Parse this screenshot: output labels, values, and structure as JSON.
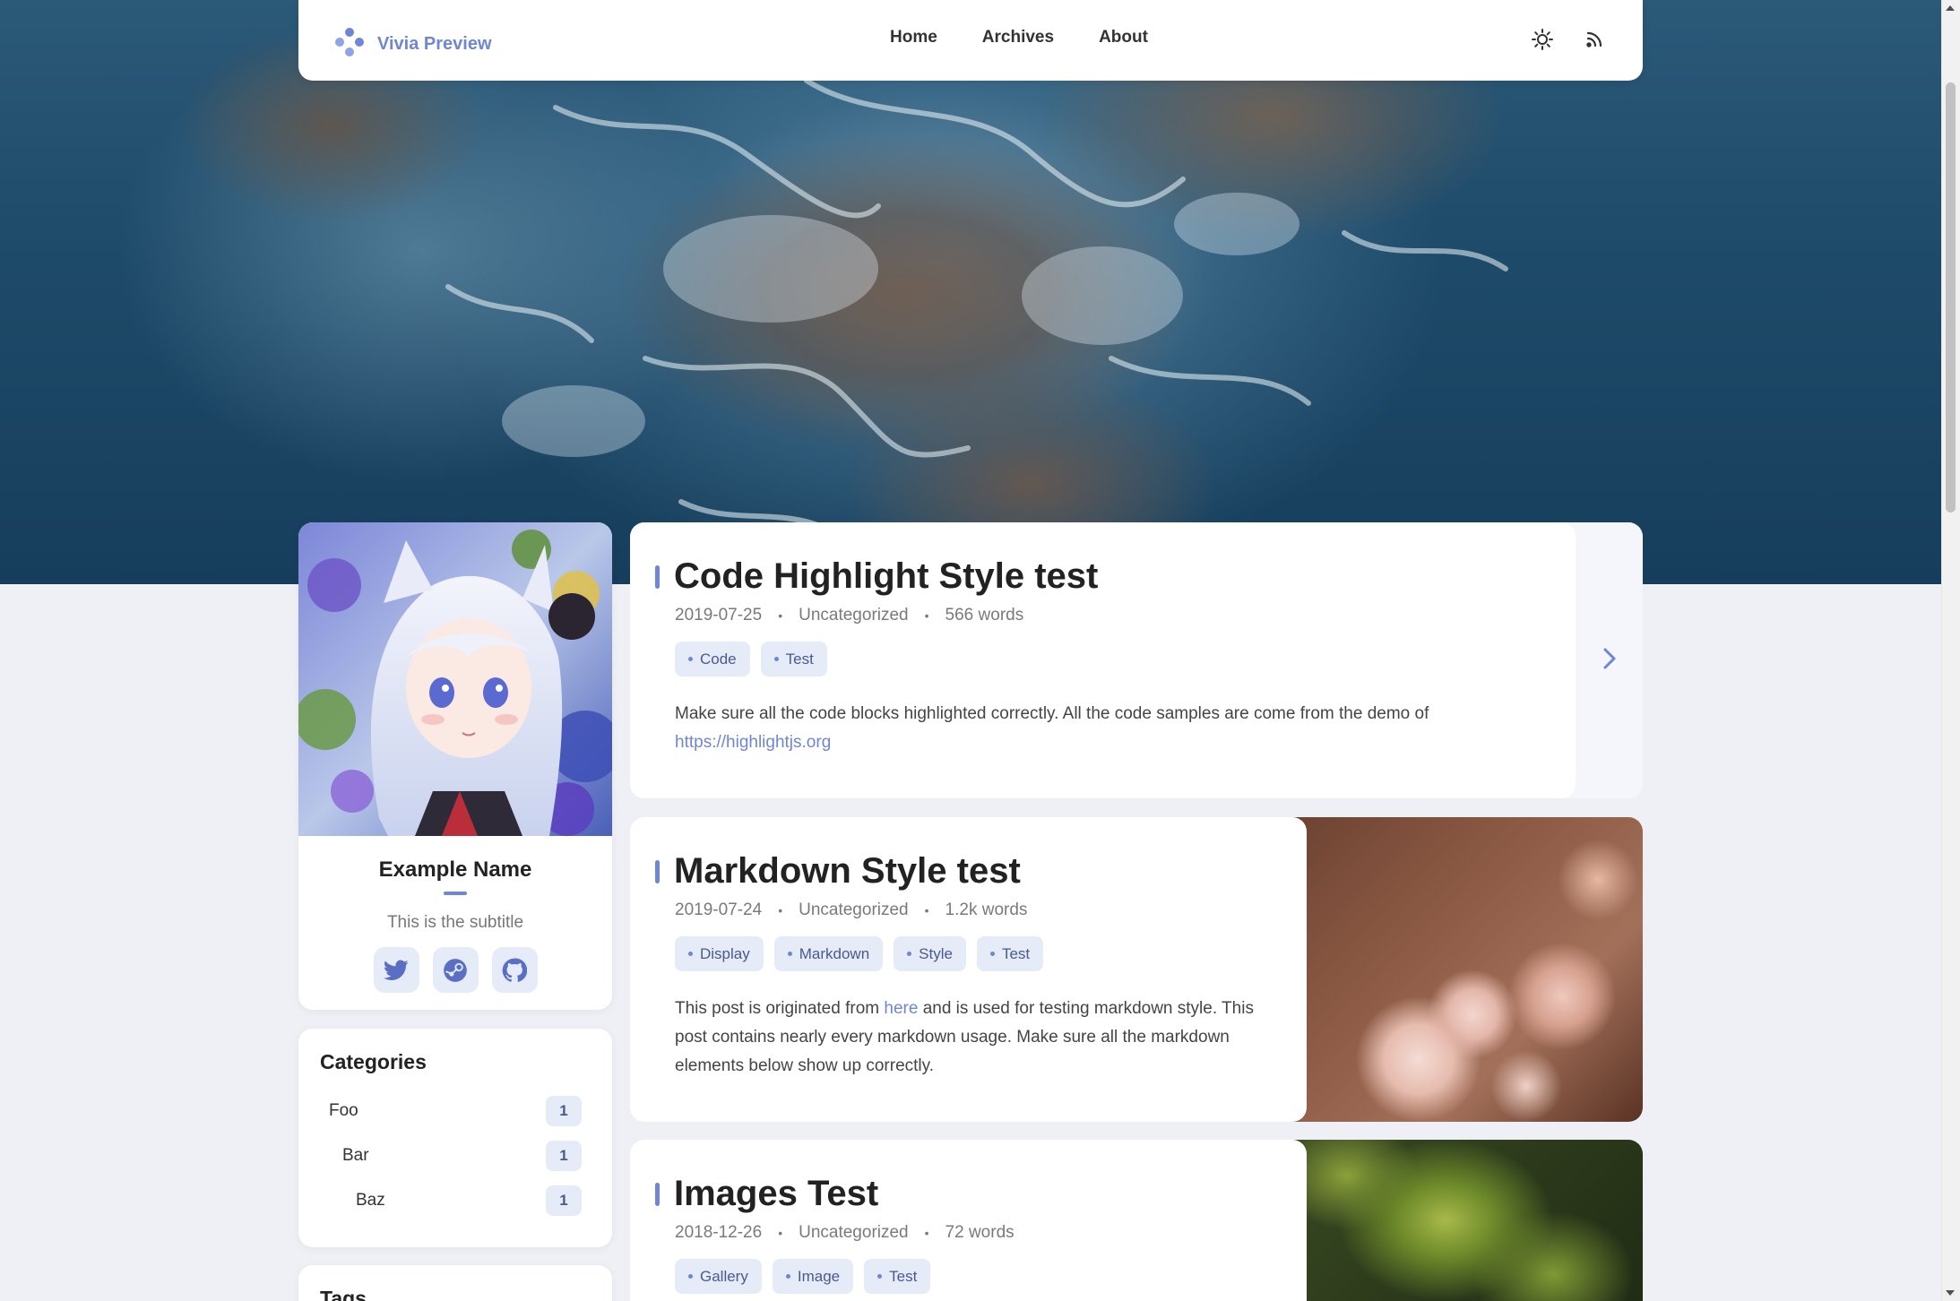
{
  "site": {
    "brand": "Vivia Preview"
  },
  "nav": {
    "items": [
      {
        "label": "Home"
      },
      {
        "label": "Archives"
      },
      {
        "label": "About"
      }
    ]
  },
  "icons": {
    "brand": "dots-logo-icon",
    "theme": "sun-icon",
    "rss": "rss-icon",
    "twitter": "twitter-icon",
    "steam": "steam-icon",
    "github": "github-icon",
    "next": "chevron-right-icon"
  },
  "colors": {
    "accent": "#6f86d6",
    "tag_bg": "#e6ebf8",
    "page_bg": "#eef0f6"
  },
  "profile": {
    "name": "Example Name",
    "subtitle": "This is the subtitle"
  },
  "categories": {
    "title": "Categories",
    "items": [
      {
        "label": "Foo",
        "count": "1"
      },
      {
        "label": "Bar",
        "count": "1"
      },
      {
        "label": "Baz",
        "count": "1"
      }
    ]
  },
  "tags_widget": {
    "title": "Tags"
  },
  "posts": [
    {
      "title": "Code Highlight Style test",
      "date": "2019-07-25",
      "category": "Uncategorized",
      "words": "566 words",
      "tags": [
        "Code",
        "Test"
      ],
      "excerpt": "Make sure all the code blocks highlighted correctly. All the code samples are come from the demo of",
      "link": "https://highlightjs.org"
    },
    {
      "title": "Markdown Style test",
      "date": "2019-07-24",
      "category": "Uncategorized",
      "words": "1.2k words",
      "tags": [
        "Display",
        "Markdown",
        "Style",
        "Test"
      ],
      "excerpt_before": "This post is originated from",
      "excerpt_link": "here",
      "excerpt_after": "and is used for testing markdown style. This post contains nearly every markdown usage. Make sure all the markdown elements below show up correctly."
    },
    {
      "title": "Images Test",
      "date": "2018-12-26",
      "category": "Uncategorized",
      "words": "72 words",
      "tags": [
        "Gallery",
        "Image",
        "Test"
      ]
    }
  ]
}
